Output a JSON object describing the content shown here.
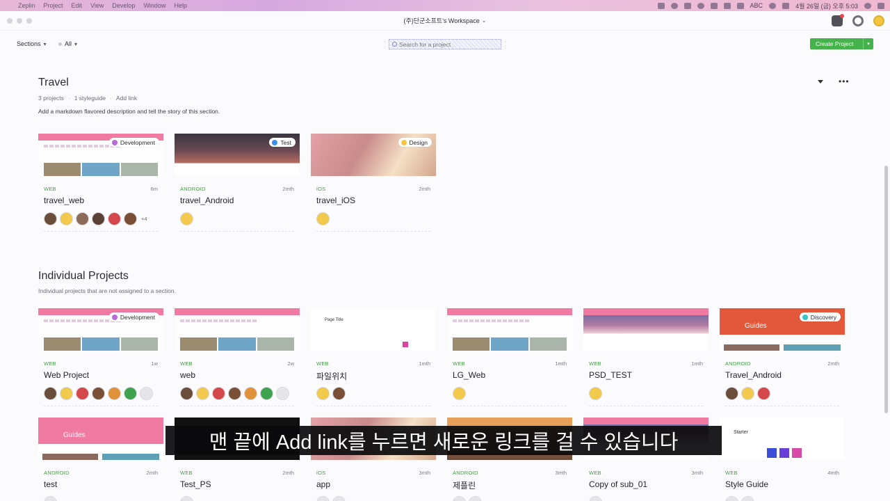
{
  "menubar": {
    "items": [
      "Zeplin",
      "Project",
      "Edit",
      "View",
      "Develop",
      "Window",
      "Help"
    ],
    "clock": "4월 26일 (금) 오후 5:03",
    "input": "ABC"
  },
  "titlebar": {
    "workspace": "(주)단군소프트's Workspace"
  },
  "toolbar": {
    "sections_label": "Sections",
    "all_label": "All",
    "search_placeholder": "Search for a project",
    "create_label": "Create Project"
  },
  "travel_section": {
    "title": "Travel",
    "meta": [
      "3 projects",
      "1 styleguide",
      "Add link"
    ],
    "description": "Add a markdown flavored description and tell the story of this section."
  },
  "individual_section": {
    "title": "Individual Projects",
    "description": "Individual projects that are not assigned to a section."
  },
  "colors": {
    "accent_green": "#45b24b",
    "development": "#b86bd8",
    "test": "#3d8fe8",
    "design": "#f5c542",
    "discovery": "#3bc4c4"
  },
  "travel_cards": [
    {
      "platform": "WEB",
      "age": "6m",
      "name": "travel_web",
      "badge": "Development",
      "more": "+4"
    },
    {
      "platform": "ANDROID",
      "age": "2mth",
      "name": "travel_Android",
      "badge": "Test"
    },
    {
      "platform": "iOS",
      "age": "2mth",
      "name": "travel_iOS",
      "badge": "Design"
    }
  ],
  "individual_cards": [
    {
      "platform": "WEB",
      "age": "1w",
      "name": "Web Project",
      "badge": "Development"
    },
    {
      "platform": "WEB",
      "age": "2w",
      "name": "web"
    },
    {
      "platform": "WEB",
      "age": "1mth",
      "name": "파일위치"
    },
    {
      "platform": "WEB",
      "age": "1mth",
      "name": "LG_Web"
    },
    {
      "platform": "WEB",
      "age": "1mth",
      "name": "PSD_TEST"
    },
    {
      "platform": "ANDROID",
      "age": "2mth",
      "name": "Travel_Android",
      "badge": "Discovery"
    },
    {
      "platform": "ANDROID",
      "age": "2mth",
      "name": "test"
    },
    {
      "platform": "WEB",
      "age": "2mth",
      "name": "Test_PS"
    },
    {
      "platform": "iOS",
      "age": "3mth",
      "name": "app"
    },
    {
      "platform": "ANDROID",
      "age": "3mth",
      "name": "제플린"
    },
    {
      "platform": "WEB",
      "age": "3mth",
      "name": "Copy of sub_01"
    },
    {
      "platform": "WEB",
      "age": "4mth",
      "name": "Style Guide"
    }
  ],
  "thumb_text": {
    "guides": "Guides",
    "page_title": "Page Title",
    "starter": "Starter"
  },
  "caption": "맨 끝에 Add link를 누르면 새로운 링크를 걸 수 있습니다"
}
